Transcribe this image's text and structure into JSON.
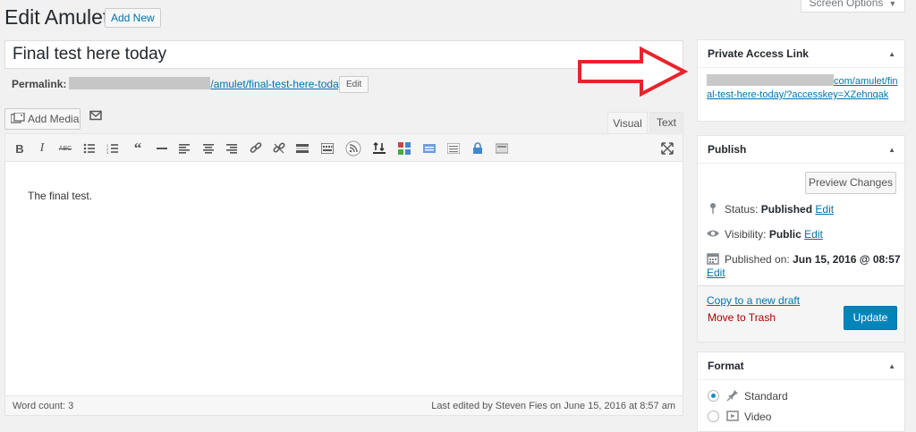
{
  "header": {
    "title": "Edit Amulet",
    "add_new": "Add New",
    "screen_options": "Screen Options"
  },
  "post": {
    "title": "Final test here today",
    "permalink_label": "Permalink:",
    "permalink_path": "/amulet/final-test-here-today/",
    "permalink_edit": "Edit"
  },
  "media": {
    "add_media": "Add Media"
  },
  "editor": {
    "tab_visual": "Visual",
    "tab_text": "Text",
    "content": "The final test.",
    "word_count": "Word count: 3",
    "last_edited": "Last edited by Steven Fies on June 15, 2016 at 8:57 am",
    "toolbar_icons": [
      "bold-icon",
      "italic-icon",
      "strikethrough-icon",
      "bullet-list-icon",
      "numbered-list-icon",
      "blockquote-icon",
      "horizontal-rule-icon",
      "align-left-icon",
      "align-center-icon",
      "align-right-icon",
      "link-icon",
      "unlink-icon",
      "read-more-icon",
      "toolbar-toggle-icon",
      "rss-icon",
      "upload-icon",
      "gallery-icon",
      "shortcode-icon",
      "form-icon",
      "lock-icon",
      "widget-icon",
      "fullscreen-icon"
    ]
  },
  "private_access": {
    "heading": "Private Access Link",
    "link_visible": "com/amulet/final-test-here-today/?accesskey=XZehnqak"
  },
  "publish": {
    "heading": "Publish",
    "preview": "Preview Changes",
    "status_label": "Status:",
    "status_value": "Published",
    "visibility_label": "Visibility:",
    "visibility_value": "Public",
    "published_label": "Published on:",
    "published_value": "Jun 15, 2016 @ 08:57",
    "edit": "Edit",
    "copy_draft": "Copy to a new draft",
    "trash": "Move to Trash",
    "update": "Update"
  },
  "format": {
    "heading": "Format",
    "options": [
      "Standard",
      "Video"
    ],
    "selected": "Standard"
  },
  "colors": {
    "accent": "#0073aa",
    "primary_button": "#0085ba",
    "trash": "#a00",
    "annotation_arrow": "#e8232b"
  }
}
